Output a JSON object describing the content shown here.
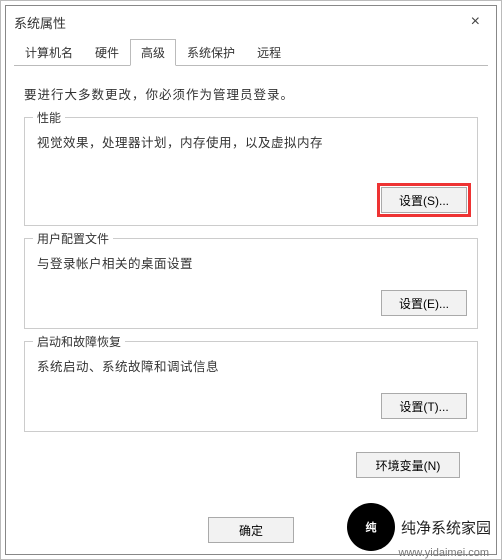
{
  "window": {
    "title": "系统属性"
  },
  "tabs": [
    "计算机名",
    "硬件",
    "高级",
    "系统保护",
    "远程"
  ],
  "active_tab_index": 2,
  "intro": "要进行大多数更改，你必须作为管理员登录。",
  "groups": {
    "performance": {
      "legend": "性能",
      "desc": "视觉效果，处理器计划，内存使用，以及虚拟内存",
      "button": "设置(S)..."
    },
    "userprofile": {
      "legend": "用户配置文件",
      "desc": "与登录帐户相关的桌面设置",
      "button": "设置(E)..."
    },
    "startup": {
      "legend": "启动和故障恢复",
      "desc": "系统启动、系统故障和调试信息",
      "button": "设置(T)..."
    }
  },
  "env_button": "环境变量(N)",
  "footer": {
    "ok": "确定"
  },
  "watermark": {
    "brand": "纯净系统家园",
    "url": "www.yidaimei.com"
  }
}
